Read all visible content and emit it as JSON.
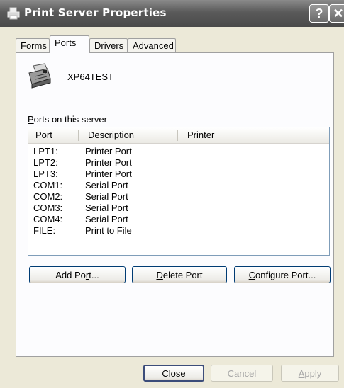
{
  "window": {
    "title": "Print Server Properties",
    "help_label": "?",
    "close_label": "✕",
    "icon": "printer-icon"
  },
  "tabs": [
    {
      "label": "Forms",
      "active": false
    },
    {
      "label": "Ports",
      "active": true
    },
    {
      "label": "Drivers",
      "active": false
    },
    {
      "label": "Advanced",
      "active": false
    }
  ],
  "server": {
    "name": "XP64TEST",
    "icon": "printer-icon"
  },
  "ports_section": {
    "label_prefix": "P",
    "label_rest": "orts on this server"
  },
  "listview": {
    "columns": [
      "Port",
      "Description",
      "Printer"
    ],
    "rows": [
      {
        "port": "LPT1:",
        "description": "Printer Port",
        "printer": ""
      },
      {
        "port": "LPT2:",
        "description": "Printer Port",
        "printer": ""
      },
      {
        "port": "LPT3:",
        "description": "Printer Port",
        "printer": ""
      },
      {
        "port": "COM1:",
        "description": "Serial Port",
        "printer": ""
      },
      {
        "port": "COM2:",
        "description": "Serial Port",
        "printer": ""
      },
      {
        "port": "COM3:",
        "description": "Serial Port",
        "printer": ""
      },
      {
        "port": "COM4:",
        "description": "Serial Port",
        "printer": ""
      },
      {
        "port": "FILE:",
        "description": "Print to File",
        "printer": ""
      }
    ]
  },
  "port_buttons": {
    "add_pre": "Add Po",
    "add_u": "r",
    "add_post": "t...",
    "delete_u": "D",
    "delete_post": "elete Port",
    "configure_u": "C",
    "configure_post": "onfigure Port..."
  },
  "footer_buttons": {
    "close": "Close",
    "cancel": "Cancel",
    "apply_u": "A",
    "apply_post": "pply"
  }
}
